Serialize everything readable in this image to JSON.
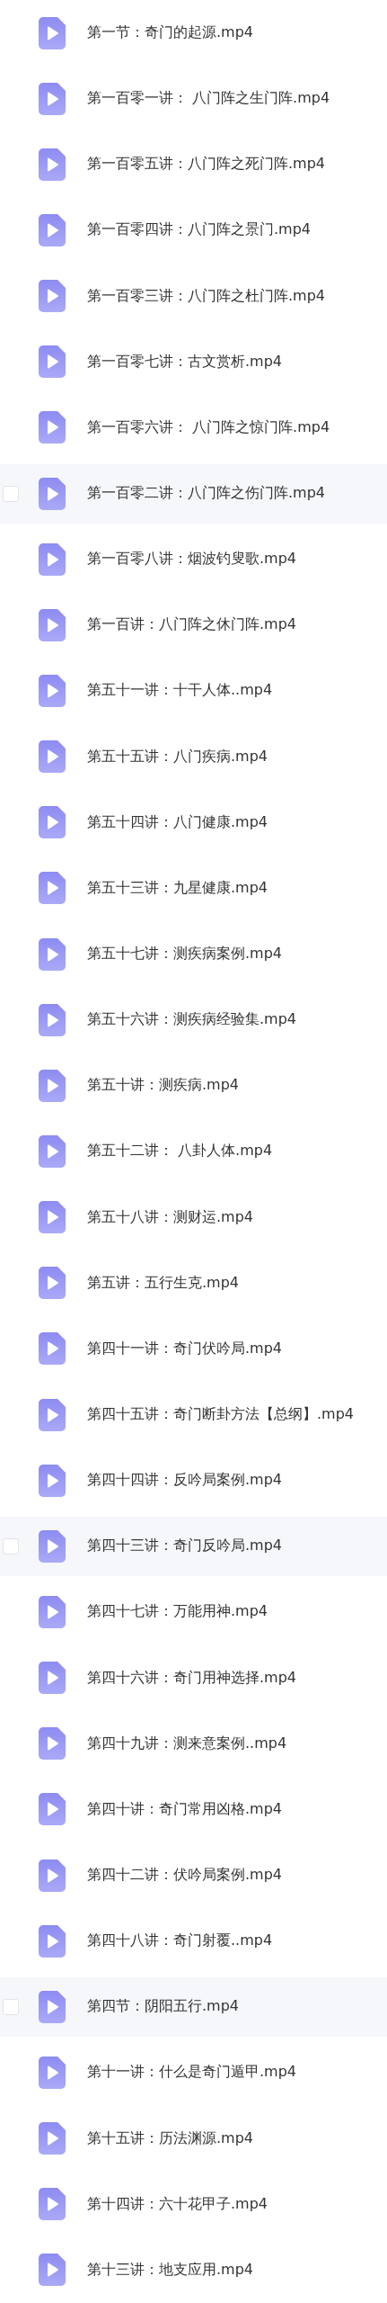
{
  "files": [
    {
      "name": "第一节：奇门的起源.mp4",
      "highlighted": false
    },
    {
      "name": "第一百零一讲： 八门阵之生门阵.mp4",
      "highlighted": false
    },
    {
      "name": "第一百零五讲：八门阵之死门阵.mp4",
      "highlighted": false
    },
    {
      "name": "第一百零四讲：八门阵之景门.mp4",
      "highlighted": false
    },
    {
      "name": "第一百零三讲：八门阵之杜门阵.mp4",
      "highlighted": false
    },
    {
      "name": "第一百零七讲：古文赏析.mp4",
      "highlighted": false
    },
    {
      "name": "第一百零六讲： 八门阵之惊门阵.mp4",
      "highlighted": false
    },
    {
      "name": "第一百零二讲：八门阵之伤门阵.mp4",
      "highlighted": true
    },
    {
      "name": "第一百零八讲：烟波钓叟歌.mp4",
      "highlighted": false
    },
    {
      "name": "第一百讲：八门阵之休门阵.mp4",
      "highlighted": false
    },
    {
      "name": "第五十一讲：十干人体..mp4",
      "highlighted": false
    },
    {
      "name": "第五十五讲：八门疾病.mp4",
      "highlighted": false
    },
    {
      "name": "第五十四讲：八门健康.mp4",
      "highlighted": false
    },
    {
      "name": "第五十三讲：九星健康.mp4",
      "highlighted": false
    },
    {
      "name": "第五十七讲：测疾病案例.mp4",
      "highlighted": false
    },
    {
      "name": "第五十六讲：测疾病经验集.mp4",
      "highlighted": false
    },
    {
      "name": "第五十讲：测疾病.mp4",
      "highlighted": false
    },
    {
      "name": "第五十二讲： 八卦人体.mp4",
      "highlighted": false
    },
    {
      "name": "第五十八讲：测财运.mp4",
      "highlighted": false
    },
    {
      "name": "第五讲：五行生克.mp4",
      "highlighted": false
    },
    {
      "name": "第四十一讲：奇门伏吟局.mp4",
      "highlighted": false
    },
    {
      "name": "第四十五讲：奇门断卦方法【总纲】.mp4",
      "highlighted": false
    },
    {
      "name": "第四十四讲：反吟局案例.mp4",
      "highlighted": false
    },
    {
      "name": "第四十三讲：奇门反吟局.mp4",
      "highlighted": true
    },
    {
      "name": "第四十七讲：万能用神.mp4",
      "highlighted": false
    },
    {
      "name": "第四十六讲：奇门用神选择.mp4",
      "highlighted": false
    },
    {
      "name": "第四十九讲：测来意案例..mp4",
      "highlighted": false
    },
    {
      "name": "第四十讲：奇门常用凶格.mp4",
      "highlighted": false
    },
    {
      "name": "第四十二讲：伏吟局案例.mp4",
      "highlighted": false
    },
    {
      "name": "第四十八讲：奇门射覆..mp4",
      "highlighted": false
    },
    {
      "name": "第四节：阴阳五行.mp4",
      "highlighted": true
    },
    {
      "name": "第十一讲：什么是奇门遁甲.mp4",
      "highlighted": false
    },
    {
      "name": "第十五讲：历法渊源.mp4",
      "highlighted": false
    },
    {
      "name": "第十四讲：六十花甲子.mp4",
      "highlighted": false
    },
    {
      "name": "第十三讲：地支应用.mp4",
      "highlighted": false
    }
  ]
}
